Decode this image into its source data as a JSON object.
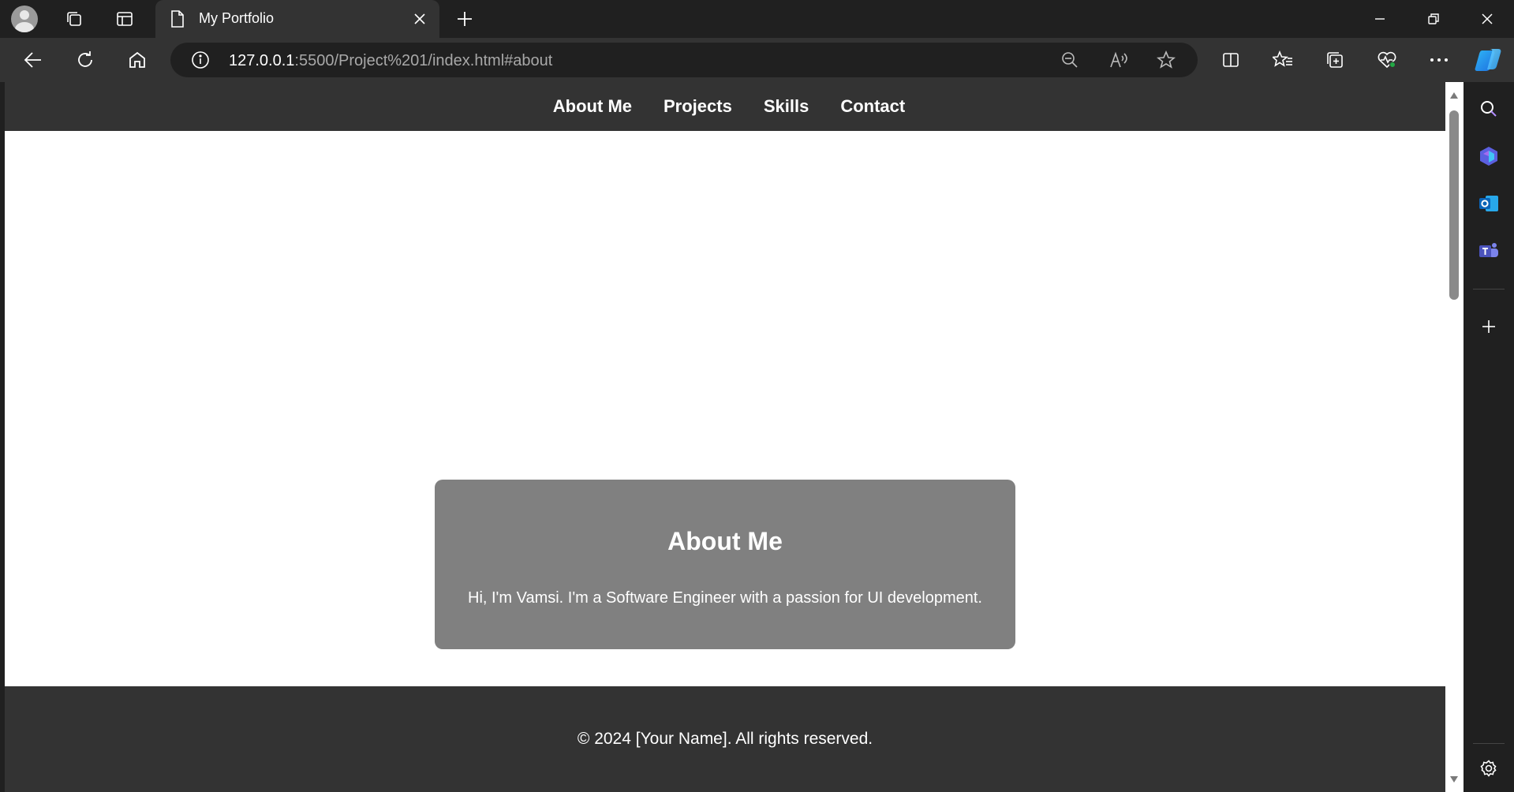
{
  "browser": {
    "tab": {
      "title": "My Portfolio"
    },
    "address": {
      "host": "127.0.0.1",
      "rest": ":5500/Project%201/index.html#about"
    }
  },
  "site": {
    "nav": [
      {
        "label": "About Me"
      },
      {
        "label": "Projects"
      },
      {
        "label": "Skills"
      },
      {
        "label": "Contact"
      }
    ],
    "about": {
      "heading": "About Me",
      "text": "Hi, I'm Vamsi. I'm a Software Engineer with a passion for UI development."
    },
    "footer": {
      "text": "© 2024 [Your Name]. All rights reserved."
    }
  },
  "icons": {
    "titlebar": [
      "profile-avatar-icon",
      "workspaces-icon",
      "tab-actions-icon",
      "page-icon",
      "close-icon",
      "new-tab-icon",
      "minimize-icon",
      "restore-icon",
      "close-window-icon"
    ],
    "toolbar": [
      "back-icon",
      "refresh-icon",
      "home-icon",
      "info-icon",
      "zoom-out-icon",
      "read-aloud-icon",
      "favorite-star-icon",
      "split-screen-icon",
      "favorites-icon",
      "collections-icon",
      "browser-essentials-icon",
      "more-icon",
      "copilot-icon"
    ],
    "sidebar": [
      "search-icon",
      "copilot-app-icon",
      "outlook-icon",
      "teams-icon",
      "add-icon",
      "settings-icon"
    ]
  },
  "colors": {
    "site_nav_bg": "#333333",
    "card_bg": "#808080",
    "browser_bg": "#202020"
  }
}
